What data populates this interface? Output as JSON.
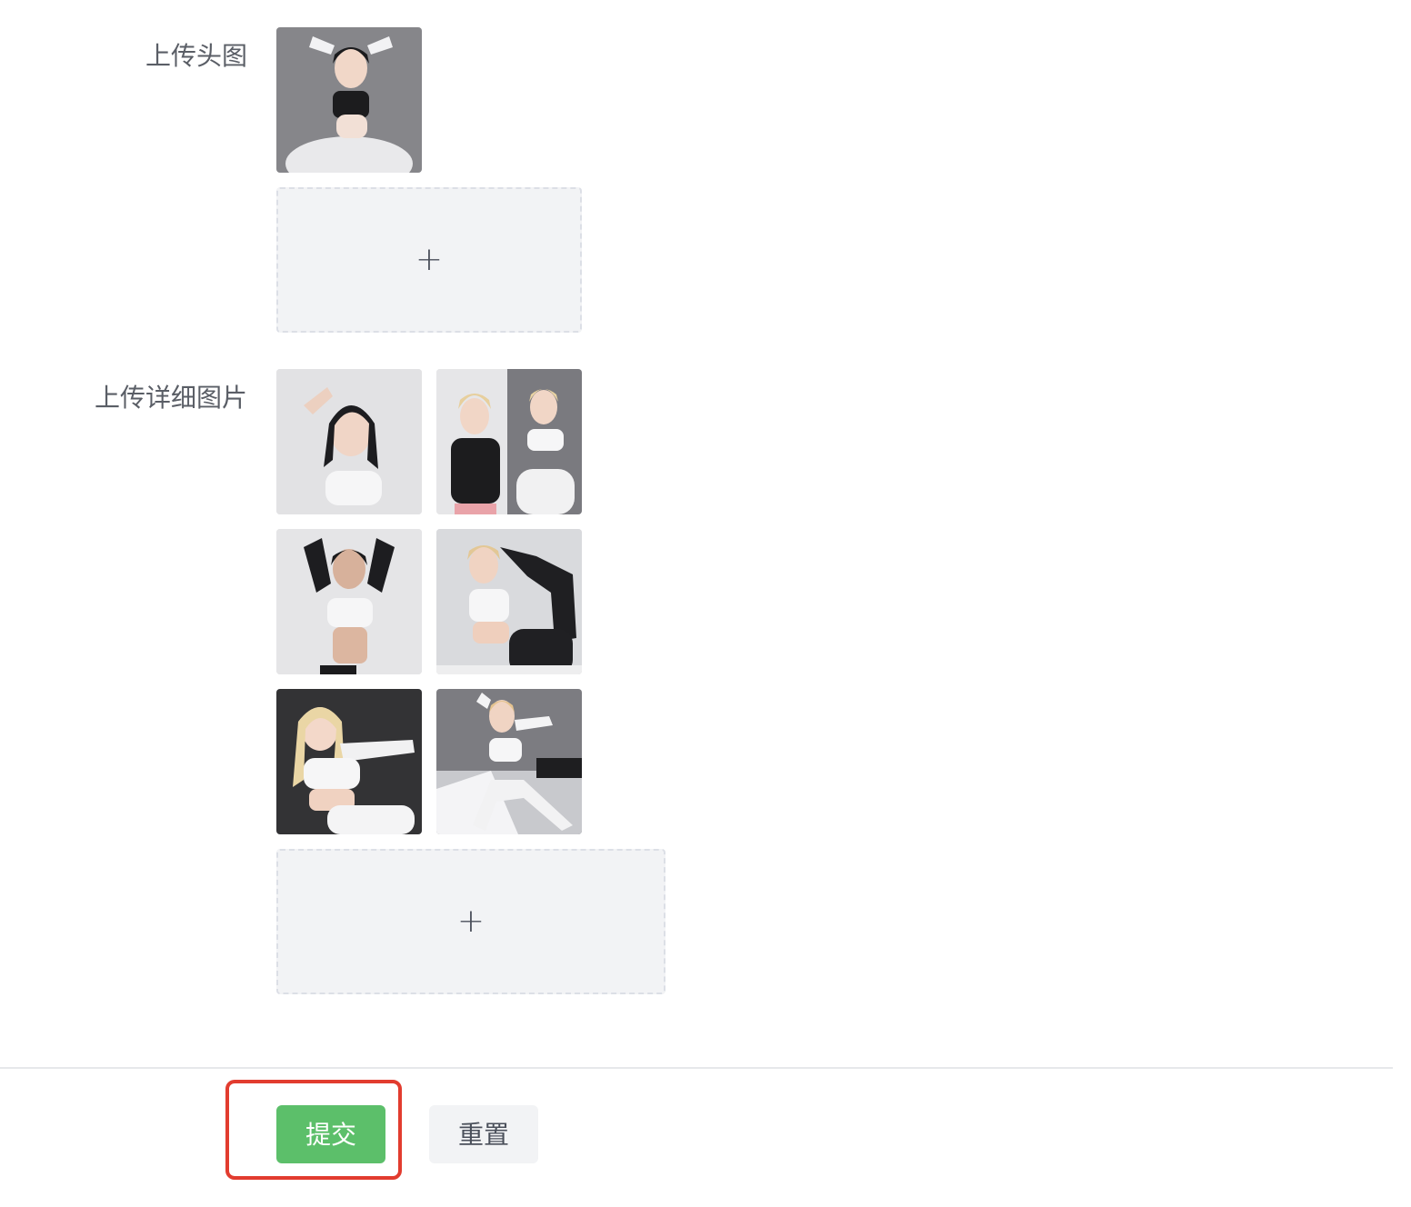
{
  "form": {
    "avatar_label": "上传头图",
    "detail_label": "上传详细图片",
    "upload_plus": "+"
  },
  "avatar_images": [
    {
      "alt": "avatar-photo",
      "tone": "#8c8c90"
    }
  ],
  "detail_images": [
    {
      "alt": "detail-photo-1",
      "tone": "#e4e4e6"
    },
    {
      "alt": "detail-photo-2",
      "tone": "#9a9a9e"
    },
    {
      "alt": "detail-photo-3",
      "tone": "#e6e6e8"
    },
    {
      "alt": "detail-photo-4",
      "tone": "#d8d9dc"
    },
    {
      "alt": "detail-photo-5",
      "tone": "#3a3a3c"
    },
    {
      "alt": "detail-photo-6",
      "tone": "#7b7b80"
    }
  ],
  "actions": {
    "submit_label": "提交",
    "reset_label": "重置"
  },
  "colors": {
    "primary": "#5cbf6a",
    "highlight": "#e23c2f",
    "label_text": "#5a5e66"
  }
}
